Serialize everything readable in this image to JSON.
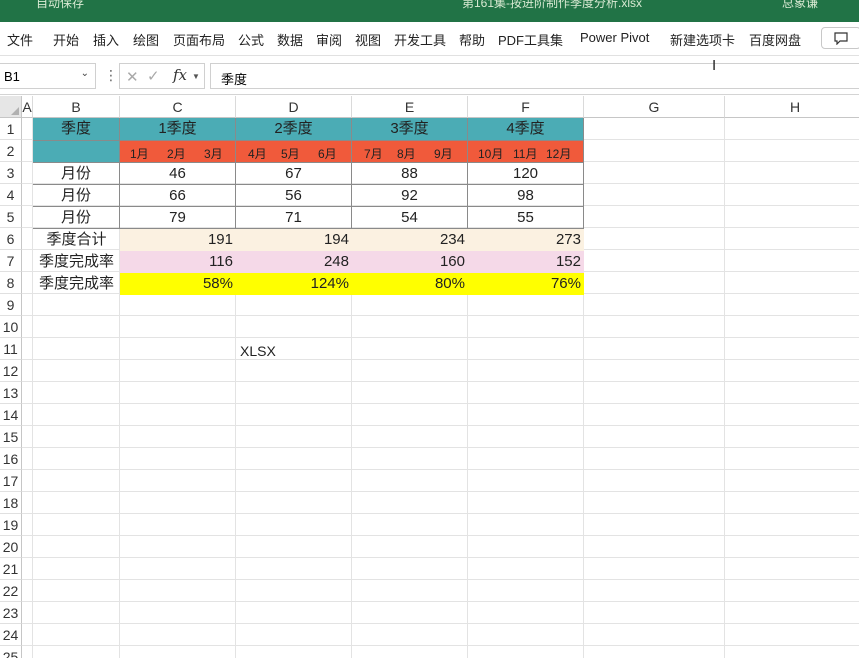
{
  "title_bar": {
    "autosave": "自动保存",
    "file_name": "第161集-按进阶制作季度分析.xlsx",
    "user": "总象谦"
  },
  "menu": [
    "文件",
    "开始",
    "插入",
    "绘图",
    "页面布局",
    "公式",
    "数据",
    "审阅",
    "视图",
    "开发工具",
    "帮助",
    "PDF工具集",
    "Power Pivot",
    "新建选项卡",
    "百度网盘"
  ],
  "formula_bar": {
    "name_box": "B1",
    "formula": "季度",
    "fx": "fx"
  },
  "columns": [
    "A",
    "B",
    "C",
    "D",
    "E",
    "F",
    "G",
    "H"
  ],
  "rows": [
    "1",
    "2",
    "3",
    "4",
    "5",
    "6",
    "7",
    "8",
    "9",
    "10",
    "11",
    "12",
    "13",
    "14",
    "15",
    "16",
    "17",
    "18",
    "19",
    "20",
    "21",
    "22",
    "23",
    "24",
    "25"
  ],
  "table": {
    "header_label": "季度",
    "quarters": [
      "1季度",
      "2季度",
      "3季度",
      "4季度"
    ],
    "months": [
      [
        "1月",
        "2月",
        "3月"
      ],
      [
        "4月",
        "5月",
        "6月"
      ],
      [
        "7月",
        "8月",
        "9月"
      ],
      [
        "10月",
        "11月",
        "12月"
      ]
    ],
    "month_rows": [
      {
        "label": "月份",
        "values": [
          "46",
          "67",
          "88",
          "120"
        ]
      },
      {
        "label": "月份",
        "values": [
          "66",
          "56",
          "92",
          "98"
        ]
      },
      {
        "label": "月份",
        "values": [
          "79",
          "71",
          "54",
          "55"
        ]
      }
    ],
    "total_row": {
      "label": "季度合计",
      "values": [
        "191",
        "194",
        "234",
        "273"
      ]
    },
    "rate_row1": {
      "label": "季度完成率",
      "values": [
        "116",
        "248",
        "160",
        "152"
      ]
    },
    "rate_row2": {
      "label": "季度完成率",
      "values": [
        "58%",
        "124%",
        "80%",
        "76%"
      ]
    }
  },
  "floating_text": "XLSX",
  "colors": {
    "title_bar": "#217346",
    "teal_header": "#4bacb5",
    "orange_months": "#f05a3b",
    "total_bg": "#fbf1e1",
    "rate_bg": "#f5d9e8",
    "highlight": "#ffff00"
  }
}
